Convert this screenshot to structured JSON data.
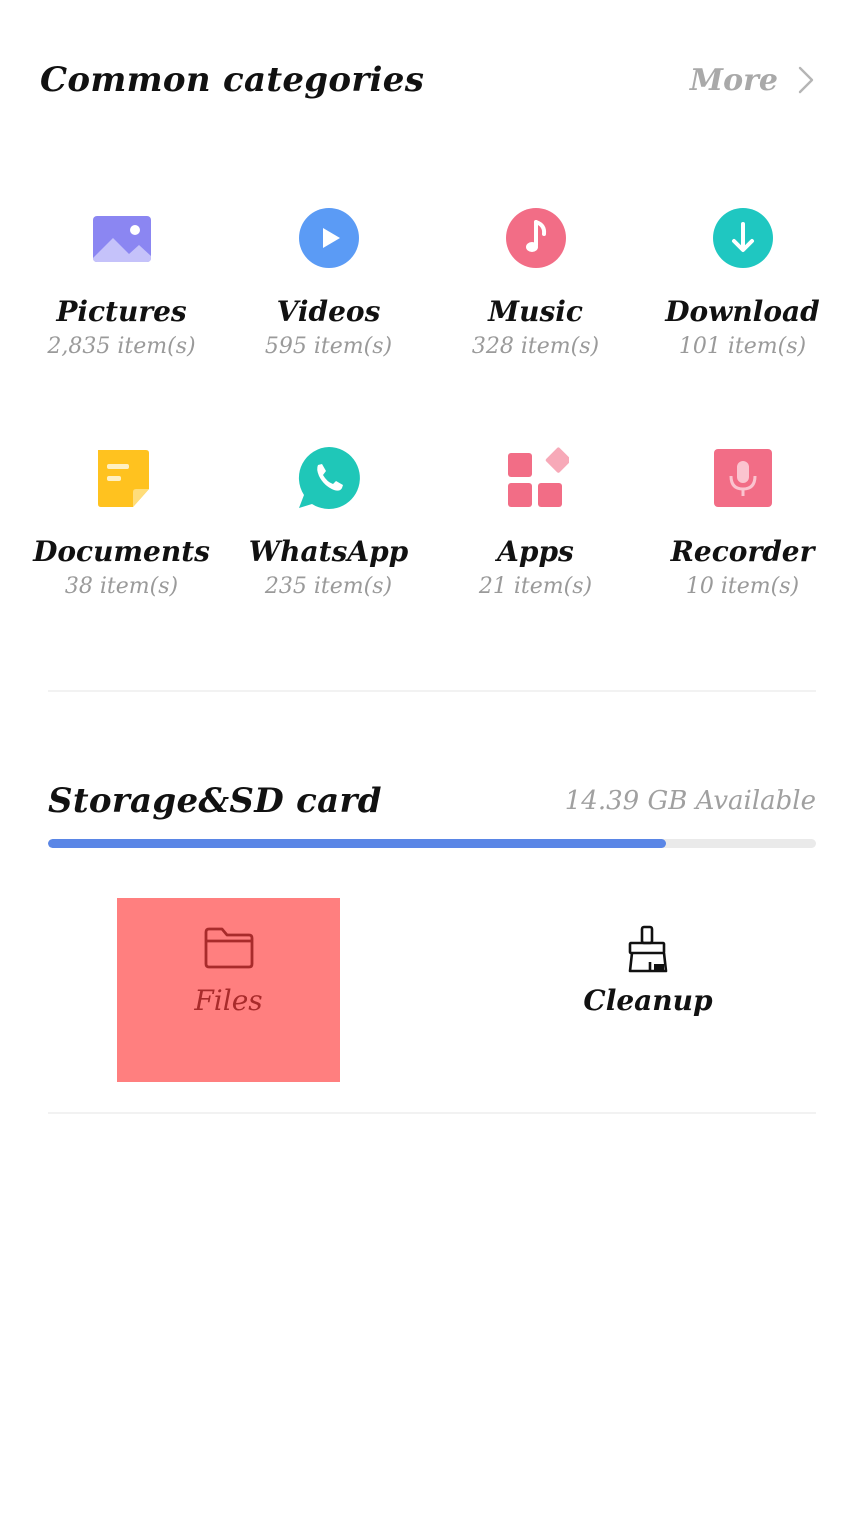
{
  "common": {
    "title": "Common categories",
    "more_label": "More"
  },
  "categories": [
    {
      "name": "Pictures",
      "count": "2,835 item(s)",
      "icon": "picture-icon",
      "color": "#8b86f2"
    },
    {
      "name": "Videos",
      "count": "595 item(s)",
      "icon": "video-play-icon",
      "color": "#5b9bf5"
    },
    {
      "name": "Music",
      "count": "328 item(s)",
      "icon": "music-note-icon",
      "color": "#f26d86"
    },
    {
      "name": "Download",
      "count": "101 item(s)",
      "icon": "download-icon",
      "color": "#1fc7c1"
    },
    {
      "name": "Documents",
      "count": "38 item(s)",
      "icon": "document-icon",
      "color": "#ffc21f"
    },
    {
      "name": "WhatsApp",
      "count": "235 item(s)",
      "icon": "whatsapp-icon",
      "color": "#1fc7b8"
    },
    {
      "name": "Apps",
      "count": "21 item(s)",
      "icon": "apps-grid-icon",
      "color": "#f26d86"
    },
    {
      "name": "Recorder",
      "count": "10 item(s)",
      "icon": "microphone-icon",
      "color": "#f26d86"
    }
  ],
  "storage": {
    "title": "Storage&SD card",
    "available": "14.39 GB Available",
    "used_fraction": 0.805,
    "bar_color": "#5a86e6"
  },
  "actions": {
    "files_label": "Files",
    "cleanup_label": "Cleanup",
    "files_highlight_color": "#ff7f7f"
  }
}
